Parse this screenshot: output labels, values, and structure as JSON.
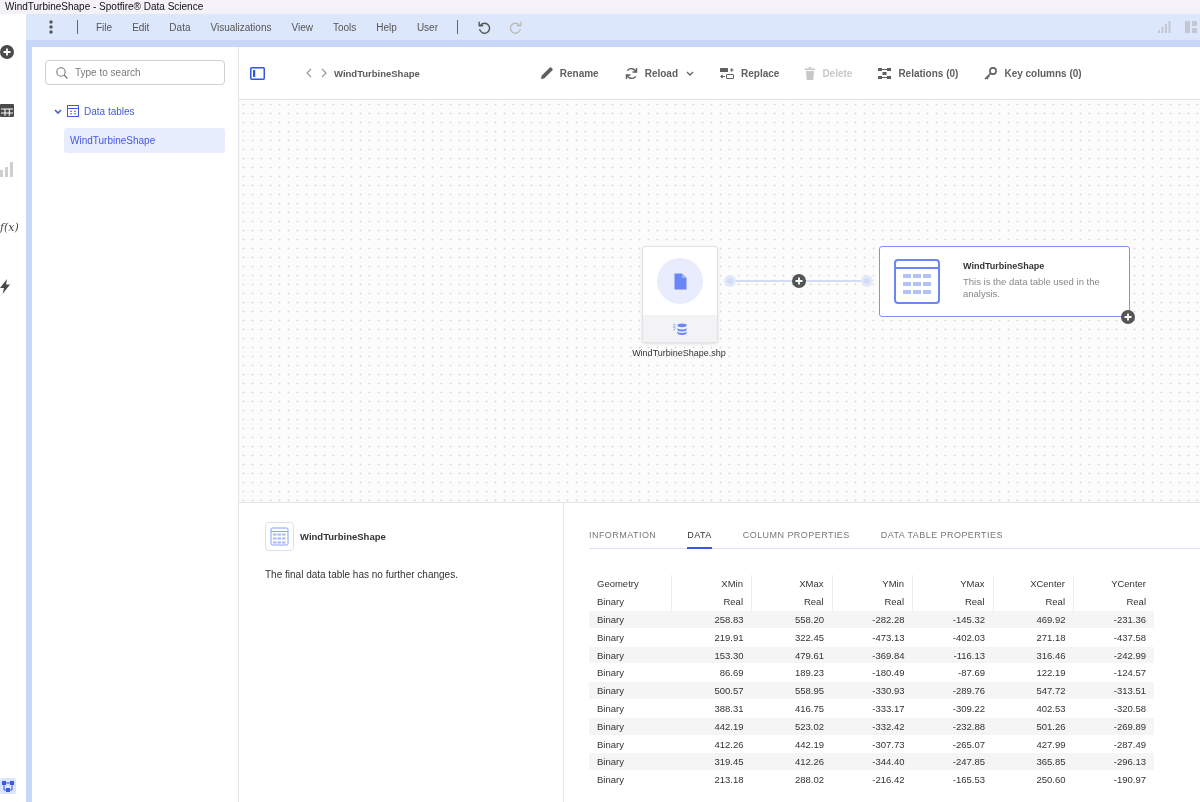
{
  "window": {
    "title": "WindTurbineShape - Spotfire® Data Science"
  },
  "rail": {
    "top": [
      {
        "kind": "add",
        "selected": false,
        "disabled": false
      },
      {
        "kind": "table",
        "selected": false,
        "disabled": false
      },
      {
        "kind": "chart",
        "selected": false,
        "disabled": true
      },
      {
        "kind": "function",
        "label": "f(x)",
        "selected": false,
        "disabled": false
      },
      {
        "kind": "action",
        "selected": false,
        "disabled": false
      }
    ],
    "bottom": [
      {
        "kind": "flow",
        "selected": true,
        "disabled": false
      }
    ]
  },
  "menu": {
    "items": [
      "File",
      "Edit",
      "Data",
      "Visualizations",
      "View",
      "Tools",
      "Help",
      "User"
    ],
    "history": [
      {
        "kind": "undo",
        "disabled": false
      },
      {
        "kind": "redo",
        "disabled": true
      }
    ],
    "tools": [
      {
        "kind": "bars",
        "disabled": true
      },
      {
        "kind": "layout",
        "disabled": true
      }
    ]
  },
  "sidebar": {
    "search": {
      "placeholder": "Type to search"
    },
    "tree": [
      {
        "label": "Data tables",
        "expanded": true,
        "children": [
          {
            "label": "WindTurbineShape",
            "selected": true
          }
        ]
      }
    ]
  },
  "toolbar": {
    "breadcrumb": "WindTurbineShape",
    "actions": [
      {
        "kind": "rename",
        "label": "Rename",
        "disabled": false,
        "has_menu": false
      },
      {
        "kind": "reload",
        "label": "Reload",
        "disabled": false,
        "has_menu": true
      },
      {
        "kind": "replace",
        "label": "Replace",
        "disabled": false,
        "has_menu": false
      },
      {
        "kind": "delete",
        "label": "Delete",
        "disabled": true,
        "has_menu": false
      },
      {
        "kind": "relations",
        "label": "Relations (0)",
        "disabled": false,
        "has_menu": false
      },
      {
        "kind": "key_columns",
        "label": "Key columns (0)",
        "disabled": false,
        "has_menu": false
      }
    ]
  },
  "canvas": {
    "source": {
      "label": "WindTurbineShape.shp"
    },
    "table_node": {
      "title": "WindTurbineShape",
      "description": "This is the data table used in the analysis."
    }
  },
  "details": {
    "title": "WindTurbineShape",
    "note": "The final data table has no further changes.",
    "tabs": [
      {
        "label": "INFORMATION",
        "selected": false
      },
      {
        "label": "DATA",
        "selected": true
      },
      {
        "label": "COLUMN PROPERTIES",
        "selected": false
      },
      {
        "label": "DATA TABLE PROPERTIES",
        "selected": false
      }
    ],
    "table": {
      "columns": [
        {
          "name": "Geometry",
          "type": "Binary",
          "kind": "text"
        },
        {
          "name": "XMin",
          "type": "Real",
          "kind": "number"
        },
        {
          "name": "XMax",
          "type": "Real",
          "kind": "number"
        },
        {
          "name": "YMin",
          "type": "Real",
          "kind": "number"
        },
        {
          "name": "YMax",
          "type": "Real",
          "kind": "number"
        },
        {
          "name": "XCenter",
          "type": "Real",
          "kind": "number"
        },
        {
          "name": "YCenter",
          "type": "Real",
          "kind": "number"
        }
      ],
      "rows": [
        [
          "Binary",
          "258.83",
          "558.20",
          "-282.28",
          "-145.32",
          "469.92",
          "-231.36"
        ],
        [
          "Binary",
          "219.91",
          "322.45",
          "-473.13",
          "-402.03",
          "271.18",
          "-437.58"
        ],
        [
          "Binary",
          "153.30",
          "479.61",
          "-369.84",
          "-116.13",
          "316.46",
          "-242.99"
        ],
        [
          "Binary",
          "86.69",
          "189.23",
          "-180.49",
          "-87.69",
          "122.19",
          "-124.57"
        ],
        [
          "Binary",
          "500.57",
          "558.95",
          "-330.93",
          "-289.76",
          "547.72",
          "-313.51"
        ],
        [
          "Binary",
          "388.31",
          "416.75",
          "-333.17",
          "-309.22",
          "402.53",
          "-320.58"
        ],
        [
          "Binary",
          "442.19",
          "523.02",
          "-332.42",
          "-232.88",
          "501.26",
          "-269.89"
        ],
        [
          "Binary",
          "412.26",
          "442.19",
          "-307.73",
          "-265.07",
          "427.99",
          "-287.49"
        ],
        [
          "Binary",
          "319.45",
          "412.26",
          "-344.40",
          "-247.85",
          "365.85",
          "-296.13"
        ],
        [
          "Binary",
          "213.18",
          "288.02",
          "-216.42",
          "-165.53",
          "250.60",
          "-190.97"
        ]
      ]
    }
  }
}
